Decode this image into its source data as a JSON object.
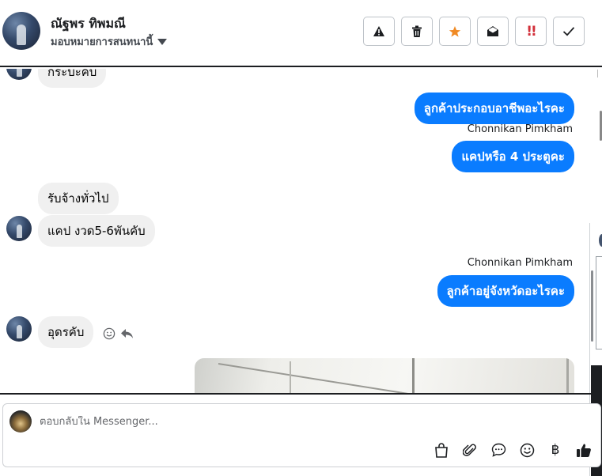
{
  "header": {
    "contact_name": "ณัฐพร ทิพมณี",
    "assign_label": "มอบหมายการสนทนานี้"
  },
  "toolbar": [
    {
      "icon": "warning-icon"
    },
    {
      "icon": "trash-icon"
    },
    {
      "icon": "star-icon"
    },
    {
      "icon": "mark-read-icon"
    },
    {
      "icon": "urgent-icon",
      "glyph": "!!"
    },
    {
      "icon": "check-icon"
    }
  ],
  "messages": {
    "partial_top": "กระบะคับ",
    "out_1": "ลูกค้าประกอบอาชีพอะไรคะ",
    "sender_1": "Chonnikan Pimkham",
    "out_2": "แคปหรือ 4 ประตูคะ",
    "in_1": "รับจ้างทั่วไป",
    "in_2": "แคป งวด5-6พันคับ",
    "sender_2": "Chonnikan Pimkham",
    "out_3": "ลูกค้าอยู่จังหวัดอะไรคะ",
    "in_3": "อุดรคับ"
  },
  "composer": {
    "placeholder": "ตอบกลับใน Messenger...",
    "icons": [
      "bag-icon",
      "paperclip-icon",
      "chat-bubble-icon",
      "emoji-icon",
      "baht-icon",
      "thumbs-up-icon"
    ],
    "baht_glyph": "฿"
  },
  "colors": {
    "outgoing_bubble": "#0a7cff",
    "incoming_bubble": "#f0f0f0",
    "star": "#f08a24",
    "urgent": "#d2303a"
  }
}
